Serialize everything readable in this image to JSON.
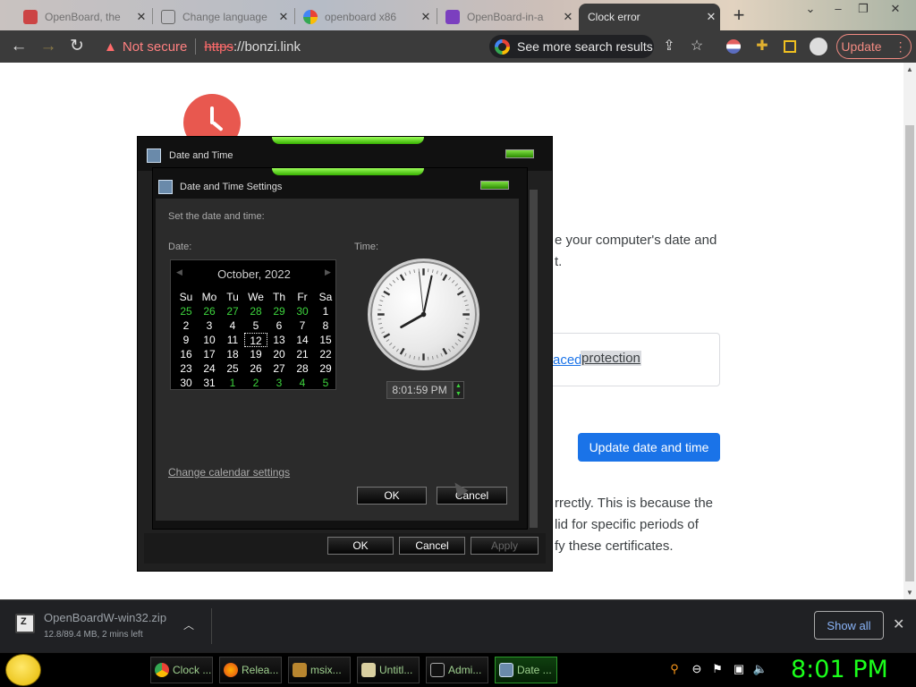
{
  "browser": {
    "tabs": [
      {
        "title": "OpenBoard, the",
        "icon": "openboard-icon",
        "active": false
      },
      {
        "title": "Change language",
        "icon": "page-icon",
        "active": false
      },
      {
        "title": "openboard x86",
        "icon": "google-icon",
        "active": false
      },
      {
        "title": "OpenBoard-in-a",
        "icon": "openboard-icon",
        "active": false
      },
      {
        "title": "Clock error",
        "icon": "warning-icon",
        "active": true
      }
    ],
    "new_tab": "+",
    "omnibox": {
      "security_label": "Not secure",
      "scheme": "https",
      "url_rest": "://bonzi.link"
    },
    "search_chip": "See more search results",
    "update_label": "Update",
    "update_menu": "⋮"
  },
  "page": {
    "line1": "e your computer's date and",
    "line2": "t.",
    "enhanced_link": "aced",
    "enhanced_text": "protection",
    "update_button": "Update date and time",
    "para1": "rrectly. This is because the",
    "para2": "lid for specific periods of",
    "para3": "fy these certificates."
  },
  "date_time_dialog": {
    "title": "Date and Time",
    "ok": "OK",
    "cancel": "Cancel",
    "apply": "Apply"
  },
  "settings_dialog": {
    "title": "Date and Time Settings",
    "instruction": "Set the date and time:",
    "date_label": "Date:",
    "time_label": "Time:",
    "calendar": {
      "month_year": "October, 2022",
      "weekdays": [
        "Su",
        "Mo",
        "Tu",
        "We",
        "Th",
        "Fr",
        "Sa"
      ],
      "weeks": [
        [
          "25",
          "26",
          "27",
          "28",
          "29",
          "30",
          "1"
        ],
        [
          "2",
          "3",
          "4",
          "5",
          "6",
          "7",
          "8"
        ],
        [
          "9",
          "10",
          "11",
          "12",
          "13",
          "14",
          "15"
        ],
        [
          "16",
          "17",
          "18",
          "19",
          "20",
          "21",
          "22"
        ],
        [
          "23",
          "24",
          "25",
          "26",
          "27",
          "28",
          "29"
        ],
        [
          "30",
          "31",
          "1",
          "2",
          "3",
          "4",
          "5"
        ]
      ],
      "selected_day": "12"
    },
    "clock": {
      "hours": 8,
      "minutes": 1,
      "seconds": 59
    },
    "time_value": "8:01:59 PM",
    "change_calendar_link": "Change calendar settings",
    "ok": "OK",
    "cancel": "Cancel"
  },
  "download": {
    "filename": "OpenBoardW-win32.zip",
    "status": "12.8/89.4 MB, 2 mins left",
    "show_all": "Show all"
  },
  "taskbar": {
    "items": [
      {
        "label": "Clock ...",
        "icon": "chrome-icon"
      },
      {
        "label": "Relea...",
        "icon": "firefox-icon"
      },
      {
        "label": "msix...",
        "icon": "archive-icon"
      },
      {
        "label": "Untitl...",
        "icon": "paint-icon"
      },
      {
        "label": "Admi...",
        "icon": "terminal-icon"
      },
      {
        "label": "Date ...",
        "icon": "calendar-icon"
      }
    ],
    "clock": "8:01 PM"
  },
  "colors": {
    "accent_green": "#1bff1b",
    "chrome_dark": "#3b3b3b",
    "link_blue": "#1a73e8"
  }
}
